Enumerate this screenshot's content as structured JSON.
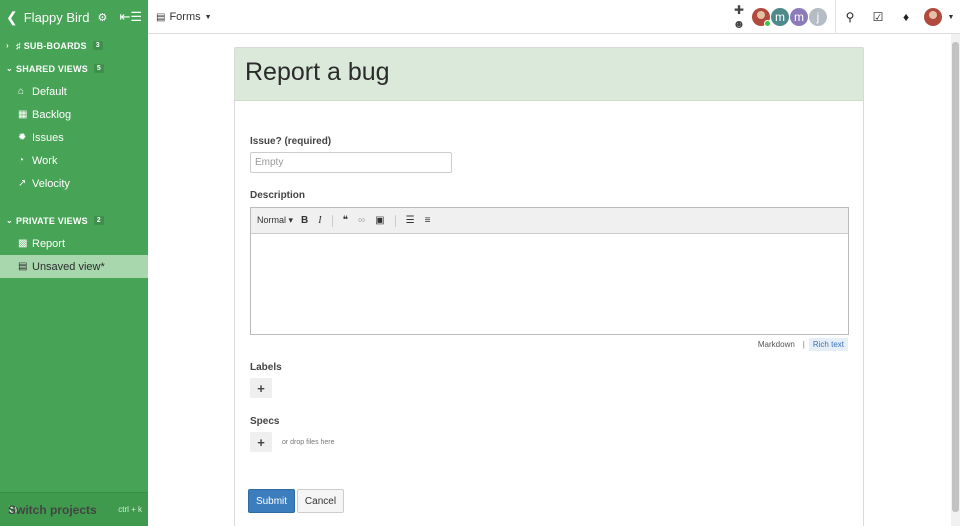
{
  "sidebar": {
    "project_title": "Flappy Bird",
    "sections": {
      "sub_boards": {
        "label": "SUB-BOARDS",
        "count": "3"
      },
      "shared_views": {
        "label": "SHARED VIEWS",
        "count": "5"
      },
      "private_views": {
        "label": "PRIVATE VIEWS",
        "count": "2"
      }
    },
    "shared_items": [
      {
        "label": "Default",
        "icon": "home-icon"
      },
      {
        "label": "Backlog",
        "icon": "grid-icon"
      },
      {
        "label": "Issues",
        "icon": "bug-icon"
      },
      {
        "label": "Work",
        "icon": "dashboard-icon"
      },
      {
        "label": "Velocity",
        "icon": "line-chart-icon"
      }
    ],
    "private_items": [
      {
        "label": "Report",
        "icon": "bar-chart-icon"
      },
      {
        "label": "Unsaved view*",
        "icon": "inbox-icon",
        "active": true
      }
    ],
    "footer": {
      "label": "Switch projects",
      "shortcut": "ctrl + k"
    }
  },
  "topbar": {
    "breadcrumb": "Forms",
    "avatars": [
      "m",
      "m",
      "j"
    ]
  },
  "form": {
    "title": "Report a bug",
    "issue_label": "Issue? (required)",
    "issue_placeholder": "Empty",
    "description_label": "Description",
    "editor_format": "Normal",
    "mode_markdown": "Markdown",
    "mode_separator": "|",
    "mode_richtext": "Rich text",
    "labels_label": "Labels",
    "specs_label": "Specs",
    "drop_hint": "or drop files here",
    "submit": "Submit",
    "cancel": "Cancel"
  },
  "colors": {
    "sidebar_bg": "#47a356",
    "sidebar_active": "#a8d7ad",
    "header_bg": "#dbe9da",
    "primary": "#3b7dbd"
  }
}
